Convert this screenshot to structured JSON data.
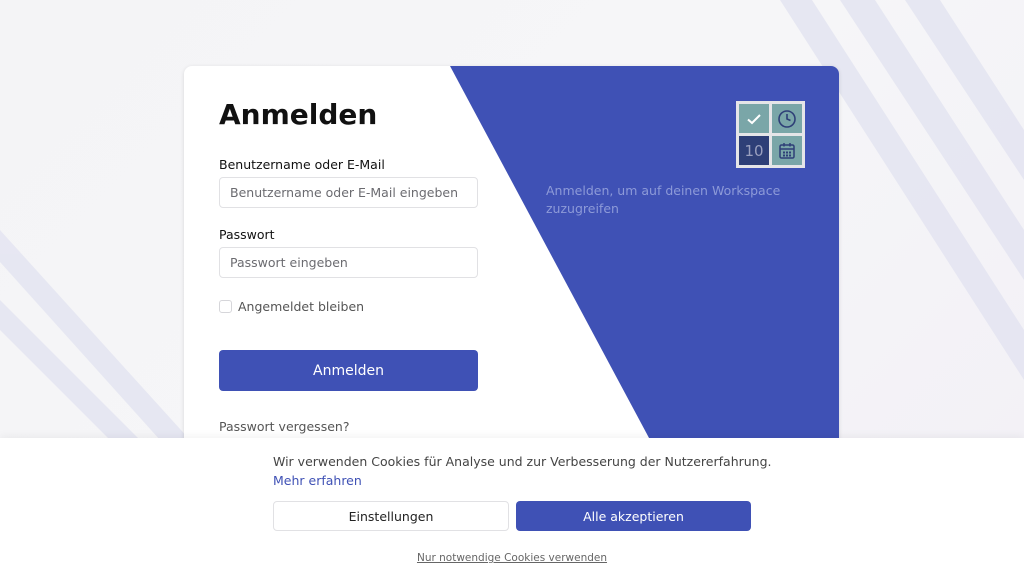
{
  "login": {
    "title": "Anmelden",
    "username_label": "Benutzername oder E-Mail",
    "username_placeholder": "Benutzername oder E-Mail eingeben",
    "username_value": "",
    "password_label": "Passwort",
    "password_placeholder": "Passwort eingeben",
    "password_value": "",
    "remember_label": "Angemeldet bleiben",
    "remember_checked": false,
    "submit_label": "Anmelden",
    "forgot_label": "Passwort vergessen?"
  },
  "side_panel": {
    "tagline": "Anmelden, um auf deinen Workspace zuzugreifen",
    "logo_number": "10",
    "logo_icons": [
      "check-icon",
      "clock-icon",
      "calendar-icon"
    ]
  },
  "cookie_banner": {
    "text": "Wir verwenden Cookies für Analyse und zur Verbesserung der Nutzererfahrung.",
    "learn_more": "Mehr erfahren",
    "settings_label": "Einstellungen",
    "accept_all_label": "Alle akzeptieren",
    "necessary_only_label": "Nur notwendige Cookies verwenden"
  },
  "colors": {
    "accent": "#3f51b5",
    "tagline": "#8d9ad8",
    "logo_teal": "#7aa6a8",
    "logo_navy": "#2e3f77"
  }
}
